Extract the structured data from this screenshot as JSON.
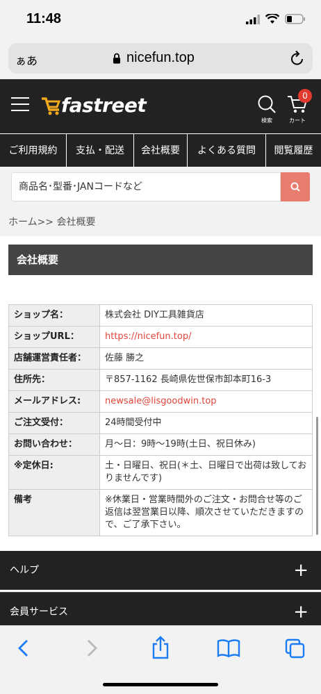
{
  "status": {
    "time": "11:48"
  },
  "browser": {
    "aa_label": "ぁあ",
    "url": "nicefun.top"
  },
  "header": {
    "logo_text": "fastreet",
    "search_label": "検索",
    "cart_label": "カート",
    "cart_count": "0"
  },
  "nav": {
    "items": [
      {
        "label": "ご利用規約"
      },
      {
        "label": "支払・配送"
      },
      {
        "label": "会社概要"
      },
      {
        "label": "よくある質問"
      },
      {
        "label": "閲覧履歴"
      }
    ]
  },
  "search": {
    "placeholder": "商品名･型番･JANコードなど"
  },
  "breadcrumb": "ホーム>> 会社概要",
  "section_title": "会社概要",
  "company_table": [
    {
      "label": "ショップ名：",
      "value": "株式会社 DIY工具雑貨店"
    },
    {
      "label": "ショップURL：",
      "value": "https://nicefun.top/"
    },
    {
      "label": "店舗運営責任者：",
      "value": "佐藤 勝之"
    },
    {
      "label": "住所先：",
      "value": "〒857-1162 長崎県佐世保市卸本町16-3"
    },
    {
      "label": "メールアドレス:",
      "value": "newsale@lisgoodwin.top"
    },
    {
      "label": "ご注文受付：",
      "value": "24時間受付中"
    },
    {
      "label": "お問い合わせ：",
      "value": "月〜日：9時〜19時(土日、祝日休み)"
    },
    {
      "label": "※定休日:",
      "value": "土・日曜日、祝日(＊土、日曜日で出荷は致しておりませんです)"
    },
    {
      "label": "備考",
      "value": "※休業日・営業時間外のご注文・お問合せ等のご返信は翌営業日以降、順次させていただきますので、ご了承下さい。"
    }
  ],
  "footer": {
    "help_label": "ヘルプ",
    "member_label": "会員サービス",
    "plus": "+"
  },
  "colors": {
    "header_bg": "#222222",
    "accent": "#e87c6f",
    "link": "#e0463a",
    "logo_cart": "#f0a81c"
  }
}
